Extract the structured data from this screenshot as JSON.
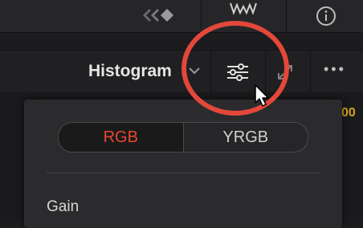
{
  "toolbar": {
    "view_label": "Histogram",
    "more_label": "•••"
  },
  "scope": {
    "axis_value": "00"
  },
  "popup": {
    "mode_options": [
      "RGB",
      "YRGB"
    ],
    "selected_mode": "RGB",
    "gain_label": "Gain"
  },
  "colors": {
    "accent_red": "#e8462f",
    "highlight_ring": "#e3483a",
    "scope_number": "#d8a51d"
  },
  "icons": {
    "top_bar": [
      "clip-icon",
      "waveform-icon",
      "info-icon"
    ],
    "toolbar": [
      "chevron-down-icon",
      "sliders-icon",
      "expand-icon",
      "more-icon"
    ],
    "cursor": "mouse-pointer-icon"
  }
}
